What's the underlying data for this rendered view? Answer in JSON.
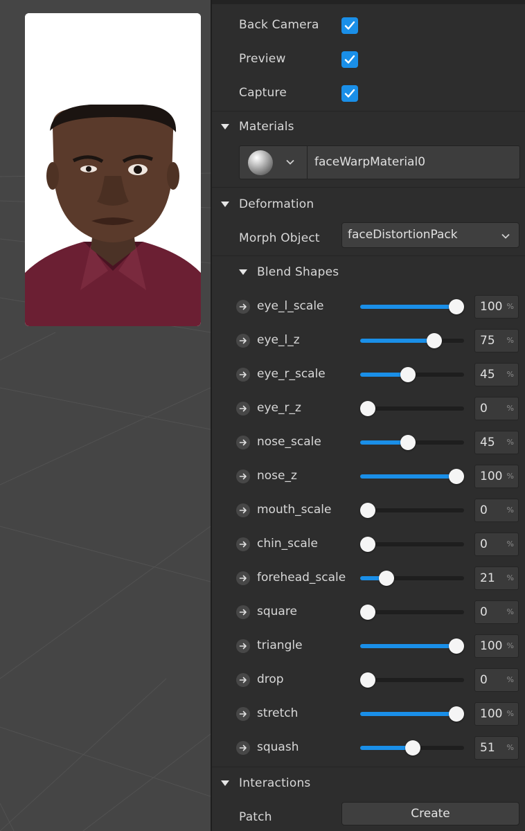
{
  "capture": {
    "back_camera_label": "Back Camera",
    "preview_label": "Preview",
    "capture_label": "Capture",
    "back_camera_checked": true,
    "preview_checked": true,
    "capture_checked": true
  },
  "materials": {
    "section_label": "Materials",
    "material_name": "faceWarpMaterial0",
    "thumbnail_icon": "sphere-icon"
  },
  "deformation": {
    "section_label": "Deformation",
    "morph_object_label": "Morph Object",
    "morph_object_value": "faceDistortionPack"
  },
  "blend_shapes": {
    "section_label": "Blend Shapes",
    "unit": "%",
    "items": [
      {
        "name": "eye_l_scale",
        "value": 100
      },
      {
        "name": "eye_l_z",
        "value": 75
      },
      {
        "name": "eye_r_scale",
        "value": 45
      },
      {
        "name": "eye_r_z",
        "value": 0
      },
      {
        "name": "nose_scale",
        "value": 45
      },
      {
        "name": "nose_z",
        "value": 100
      },
      {
        "name": "mouth_scale",
        "value": 0
      },
      {
        "name": "chin_scale",
        "value": 0
      },
      {
        "name": "forehead_scale",
        "value": 21
      },
      {
        "name": "square",
        "value": 0
      },
      {
        "name": "triangle",
        "value": 100
      },
      {
        "name": "drop",
        "value": 0
      },
      {
        "name": "stretch",
        "value": 100
      },
      {
        "name": "squash",
        "value": 51
      }
    ]
  },
  "interactions": {
    "section_label": "Interactions",
    "patch_label": "Patch",
    "create_button_label": "Create"
  },
  "colors": {
    "accent": "#1a8fe8",
    "panel_bg": "#2d2d2d",
    "viewport_bg": "#454545"
  }
}
